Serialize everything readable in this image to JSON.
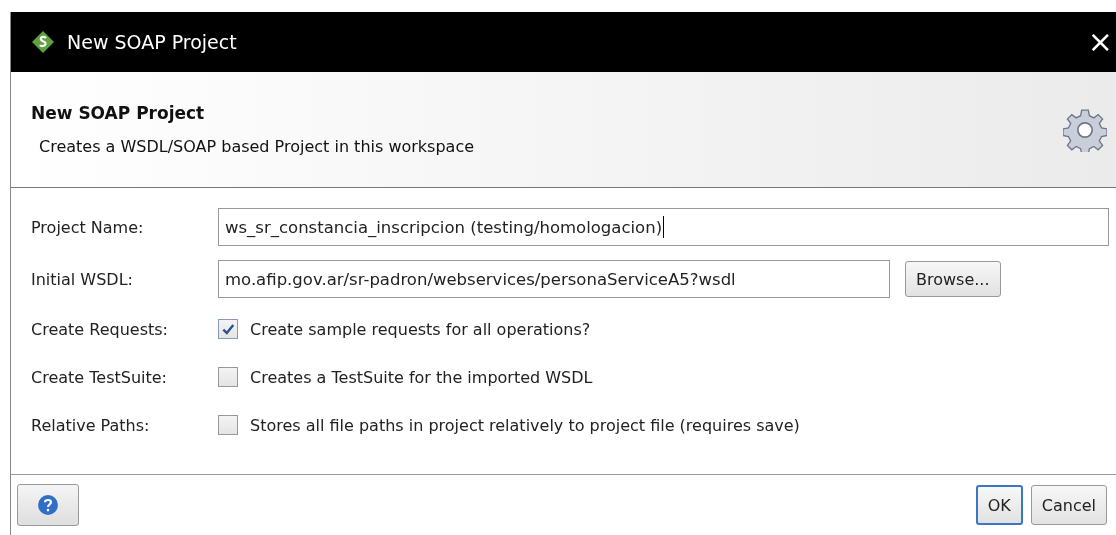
{
  "window": {
    "title": "New SOAP Project",
    "close": "×"
  },
  "header": {
    "title": "New SOAP Project",
    "subtitle": "Creates a WSDL/SOAP based Project in this workspace"
  },
  "fields": [
    {
      "kind": "text",
      "label": "Project Name:",
      "value": "ws_sr_constancia_inscripcion (testing/homologacion)"
    },
    {
      "kind": "file",
      "label": "Initial WSDL:",
      "value": "mo.afip.gov.ar/sr-padron/webservices/personaServiceA5?wsdl",
      "button": "Browse..."
    },
    {
      "kind": "checkbox",
      "label": "Create Requests:",
      "text": "Create sample requests for all operations?",
      "checked": true
    },
    {
      "kind": "checkbox",
      "label": "Create TestSuite:",
      "text": "Creates a TestSuite for the imported WSDL",
      "checked": false
    },
    {
      "kind": "checkbox",
      "label": "Relative Paths:",
      "text": "Stores all file paths in project relatively to project file (requires save)",
      "checked": false
    }
  ],
  "buttons": [
    {
      "label": "OK",
      "selected": true
    },
    {
      "label": "Cancel",
      "selected": false
    }
  ]
}
